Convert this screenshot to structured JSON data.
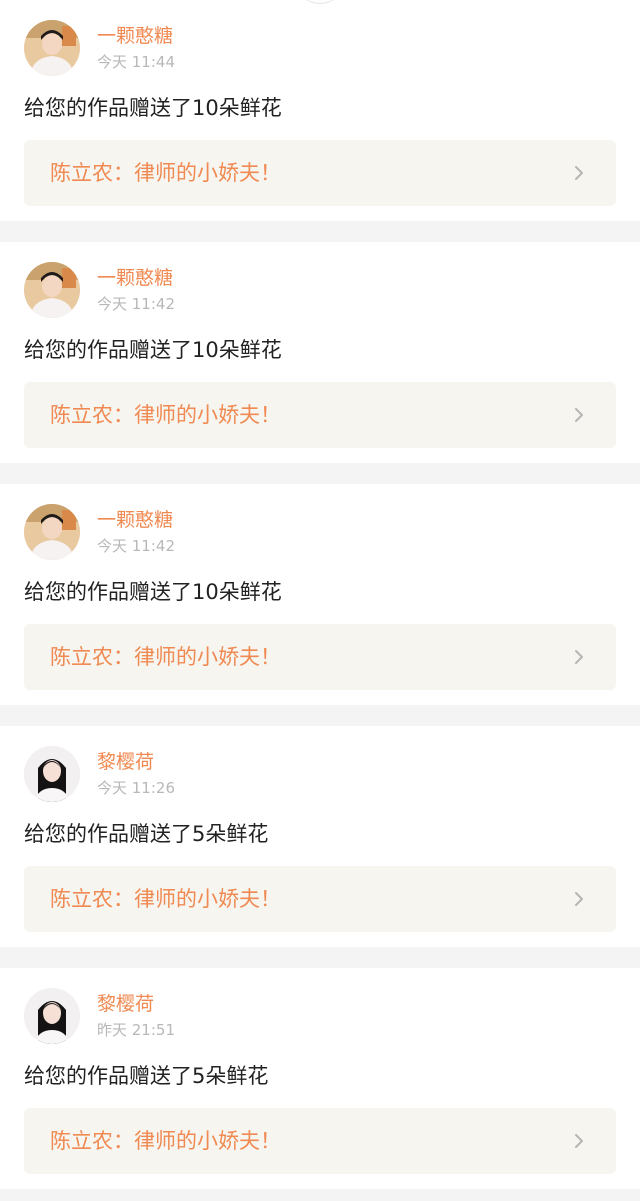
{
  "feed": {
    "items": [
      {
        "username": "一颗憨糖",
        "time": "今天 11:44",
        "message": "给您的作品赠送了10朵鲜花",
        "work_title": "陈立农：律师的小娇夫！",
        "avatar": "male-avatar"
      },
      {
        "username": "一颗憨糖",
        "time": "今天 11:42",
        "message": "给您的作品赠送了10朵鲜花",
        "work_title": "陈立农：律师的小娇夫！",
        "avatar": "male-avatar"
      },
      {
        "username": "一颗憨糖",
        "time": "今天 11:42",
        "message": "给您的作品赠送了10朵鲜花",
        "work_title": "陈立农：律师的小娇夫！",
        "avatar": "male-avatar"
      },
      {
        "username": "黎樱荷",
        "time": "今天 11:26",
        "message": "给您的作品赠送了5朵鲜花",
        "work_title": "陈立农：律师的小娇夫！",
        "avatar": "female-avatar"
      },
      {
        "username": "黎樱荷",
        "time": "昨天 21:51",
        "message": "给您的作品赠送了5朵鲜花",
        "work_title": "陈立农：律师的小娇夫！",
        "avatar": "female-avatar"
      }
    ]
  },
  "colors": {
    "accent": "#f08a52",
    "muted_text": "#b8b8b8",
    "body_text": "#222222",
    "link_bg": "#f6f5f0",
    "page_bg": "#f4f4f4"
  },
  "icons": {
    "chevron": "chevron-right-icon"
  }
}
